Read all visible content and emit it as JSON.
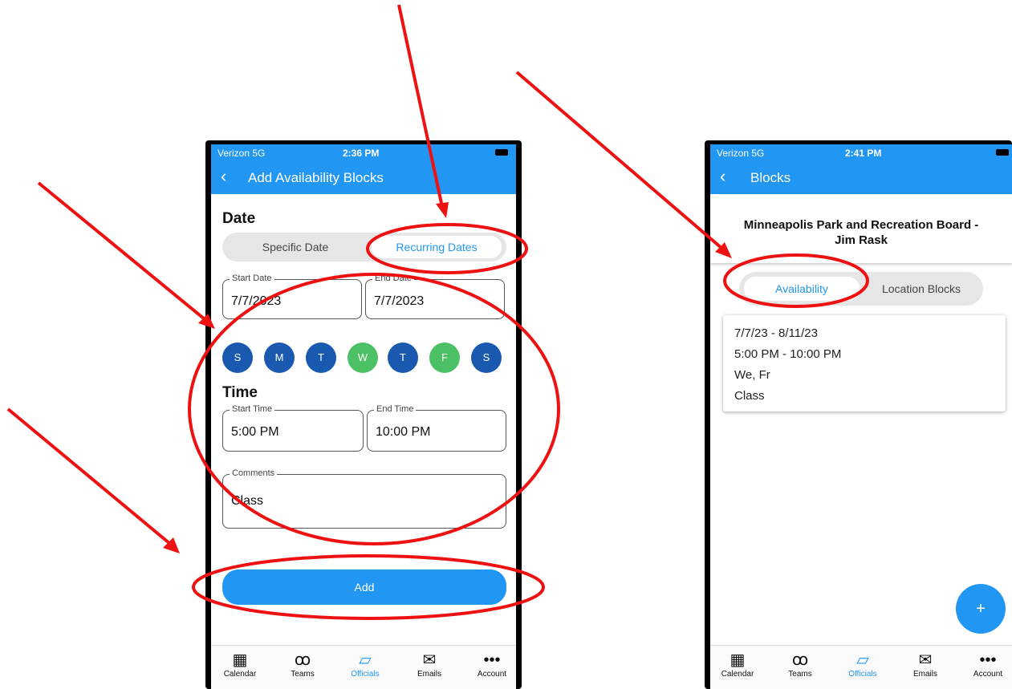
{
  "left_phone": {
    "status": {
      "carrier": "Verizon 5G",
      "time": "2:36 PM"
    },
    "appbar": {
      "back": "‹",
      "title": "Add Availability Blocks"
    },
    "date_heading": "Date",
    "segment": {
      "specific": "Specific Date",
      "recurring": "Recurring Dates"
    },
    "start_date": {
      "label": "Start Date",
      "value": "7/7/2023"
    },
    "end_date": {
      "label": "End Date",
      "value": "7/7/2023"
    },
    "days": [
      {
        "letter": "S",
        "selected": false
      },
      {
        "letter": "M",
        "selected": false
      },
      {
        "letter": "T",
        "selected": false
      },
      {
        "letter": "W",
        "selected": true
      },
      {
        "letter": "T",
        "selected": false
      },
      {
        "letter": "F",
        "selected": true
      },
      {
        "letter": "S",
        "selected": false
      }
    ],
    "time_heading": "Time",
    "start_time": {
      "label": "Start Time",
      "value": "5:00 PM"
    },
    "end_time": {
      "label": "End Time",
      "value": "10:00 PM"
    },
    "comments": {
      "label": "Comments",
      "value": "Class"
    },
    "add_label": "Add"
  },
  "right_phone": {
    "status": {
      "carrier": "Verizon 5G",
      "time": "2:41 PM"
    },
    "appbar": {
      "back": "‹",
      "title": "Blocks"
    },
    "header_title_line1": "Minneapolis Park and Recreation Board -",
    "header_title_line2": "Jim Rask",
    "segment": {
      "availability": "Availability",
      "location": "Location Blocks"
    },
    "block": {
      "dates": "7/7/23 - 8/11/23",
      "times": "5:00 PM - 10:00 PM",
      "days": "We, Fr",
      "comment": "Class"
    },
    "fab": "+"
  },
  "tabbar": [
    {
      "label": "Calendar",
      "icon": "calendar-icon",
      "glyph": "▦"
    },
    {
      "label": "Teams",
      "icon": "teams-icon",
      "glyph": "ꝏ"
    },
    {
      "label": "Officials",
      "icon": "officials-icon",
      "glyph": "▱"
    },
    {
      "label": "Emails",
      "icon": "email-icon",
      "glyph": "✉"
    },
    {
      "label": "Account",
      "icon": "more-icon",
      "glyph": "•••"
    }
  ],
  "colors": {
    "accent": "#2196f3",
    "day_off": "#1a59b0",
    "day_on": "#4cc064",
    "annotation": "#ee1111"
  }
}
